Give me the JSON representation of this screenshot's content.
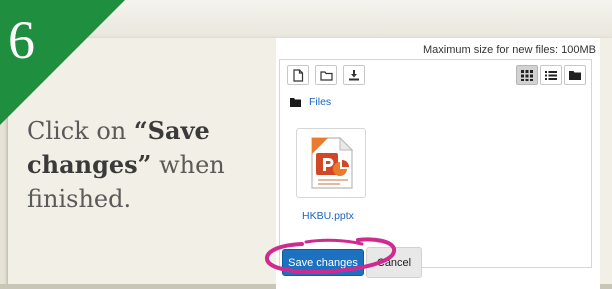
{
  "step": {
    "number": "6"
  },
  "instruction": {
    "prefix": "Click on ",
    "bold_line1": "“Save",
    "bold_line2": "changes”",
    "middle": " when",
    "suffix": "finished."
  },
  "filemanager": {
    "max_size_text": "Maximum size for new files: 100MB",
    "toolbar": {
      "left_icons": [
        "new-file-icon",
        "new-folder-icon",
        "download-icon"
      ],
      "right_icons": [
        "grid-view-icon",
        "list-view-icon",
        "folder-view-icon"
      ],
      "active_view": "grid-view-icon"
    },
    "breadcrumb_label": "Files",
    "files": [
      {
        "name": "HKBU.pptx",
        "icon": "powerpoint-file-icon"
      }
    ]
  },
  "buttons": {
    "save_label": "Save changes",
    "cancel_label": "Cancel"
  },
  "colors": {
    "corner_green": "#1f8e3e",
    "save_button": "#1c71c1",
    "highlight_ring": "#cf2a8f",
    "link_blue": "#1a64c0"
  }
}
